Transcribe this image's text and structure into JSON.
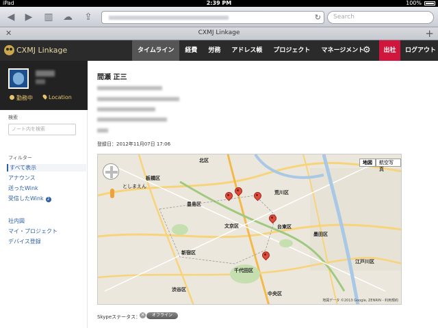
{
  "statusbar": {
    "left": "iPad",
    "time": "2:39 PM",
    "battery": "100%"
  },
  "browser": {
    "search_placeholder": "Search",
    "tab_title": "CXMJ Linkage"
  },
  "app": {
    "brand": "CXMJ Linkage",
    "nav": [
      "タイムライン",
      "経費",
      "労務",
      "アドレス帳",
      "プロジェクト",
      "マネージメント"
    ],
    "active_nav": "タイムライン",
    "shukkin_label": "出社",
    "logout_label": "ログアウト"
  },
  "sidebar": {
    "status": "勤務中",
    "location": "Location",
    "search_title": "検索",
    "search_placeholder": "ノート内を検索",
    "filter_title": "フィルター",
    "filters": [
      "すべて表示",
      "アナウンス",
      "送ったWink",
      "受信したWink"
    ],
    "wink_badge": "2",
    "links": [
      "社内図",
      "マイ・プロジェクト",
      "デバイス登録"
    ]
  },
  "main": {
    "person_name": "間瀬 正三",
    "registered": "登録日：2012年11月07日 17:06",
    "skype_label": "Skypeステータス：",
    "skype_status": "オフライン"
  },
  "map": {
    "btn_map": "地図",
    "btn_satellite": "航空写真",
    "labels": [
      "北区",
      "荒川区",
      "板橋区",
      "豊島区",
      "文京区",
      "台東区",
      "墨田区",
      "新宿区",
      "千代田区",
      "中央区",
      "渋谷区",
      "江戸川区",
      "としまえん"
    ],
    "copyright": "地図データ ©2013 Google, ZENRIN - 利用規約"
  }
}
